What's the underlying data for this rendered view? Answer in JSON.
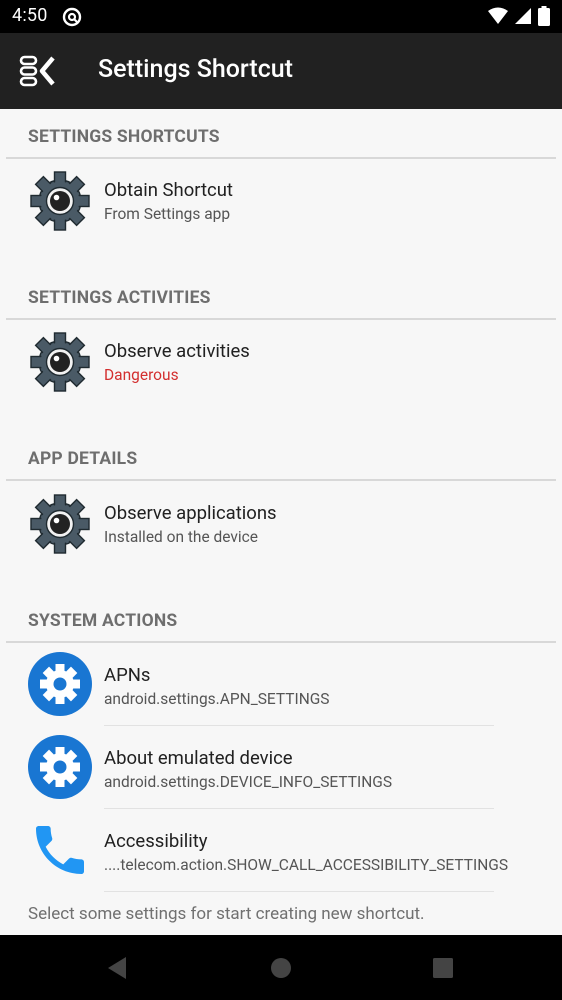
{
  "status_bar": {
    "time": "4:50",
    "app_icon": "at-sign-icon",
    "icons": [
      "wifi-icon",
      "cell-signal-icon",
      "battery-icon"
    ]
  },
  "app_bar": {
    "menu_icon": "menu-back-icon",
    "title": "Settings Shortcut"
  },
  "sections": [
    {
      "header": "SETTINGS SHORTCUTS",
      "items": [
        {
          "icon": "gear-camera-icon",
          "primary": "Obtain Shortcut",
          "secondary": "From Settings app"
        }
      ]
    },
    {
      "header": "SETTINGS ACTIVITIES",
      "items": [
        {
          "icon": "gear-camera-icon",
          "primary": "Observe activities",
          "secondary": "Dangerous",
          "secondary_color": "#d32f2f"
        }
      ]
    },
    {
      "header": "APP DETAILS",
      "items": [
        {
          "icon": "gear-camera-icon",
          "primary": "Observe applications",
          "secondary": "Installed on the device"
        }
      ]
    },
    {
      "header": "SYSTEM ACTIONS",
      "items": [
        {
          "icon": "blue-gear-icon",
          "primary": "APNs",
          "secondary": "android.settings.APN_SETTINGS"
        },
        {
          "icon": "blue-gear-icon",
          "primary": "About emulated device",
          "secondary": "android.settings.DEVICE_INFO_SETTINGS"
        },
        {
          "icon": "phone-icon",
          "primary": "Accessibility",
          "secondary": "....telecom.action.SHOW_CALL_ACCESSIBILITY_SETTINGS"
        }
      ]
    }
  ],
  "hint": "Select some settings for start creating new shortcut.",
  "nav_bar": {
    "buttons": [
      "back-icon",
      "home-icon",
      "recents-icon"
    ]
  },
  "colors": {
    "app_bar": "#212121",
    "accent_blue": "#1976d2",
    "danger": "#d32f2f",
    "gear_gray": "#4a5a66"
  }
}
